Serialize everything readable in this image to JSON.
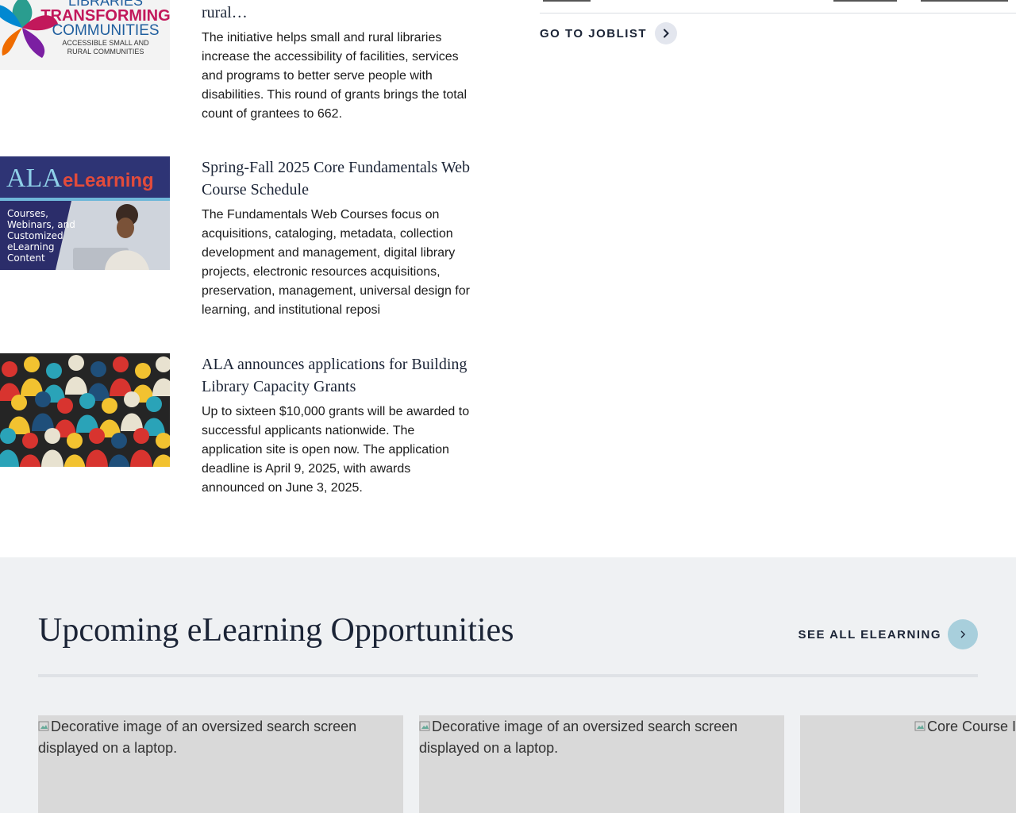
{
  "news": [
    {
      "title_fragment": "rural…",
      "logo": {
        "line1": "LIBRARIES",
        "line2": "TRANSFORMING",
        "line3": "COMMUNITIES",
        "line4": "ACCESSIBLE SMALL AND",
        "line5": "RURAL COMMUNITIES"
      },
      "desc": "The initiative helps small and rural libraries increase the accessibility of facilities, services and programs to better serve people with disabilities. This round of grants brings the total count of grantees to 662."
    },
    {
      "title": "Spring-Fall 2025 Core Fundamentals Web Course Schedule",
      "banner": {
        "ala": "ALA",
        "elearning": "eLearning",
        "l1": "Courses,",
        "l2": "Webinars, and",
        "l3": "Customized",
        "l4": "eLearning",
        "l5": "Content"
      },
      "desc": "The Fundamentals Web Courses focus on acquisitions, cataloging, metadata, collection development and management, digital library projects, electronic resources acquisitions, preservation, management, universal design for learning, and institutional reposi"
    },
    {
      "title": "ALA announces applications for Building Library Capacity Grants",
      "desc": "Up to sixteen $10,000 grants will be awarded to successful applicants nationwide. The application site is open now. The application deadline is April 9, 2025, with awards announced on June 3, 2025."
    }
  ],
  "joblist": {
    "link_label": "GO TO JOBLIST"
  },
  "elearning": {
    "heading": "Upcoming eLearning Opportunities",
    "see_all_label": "SEE ALL ELEARNING",
    "cards": [
      {
        "image_alt": "Decorative image of an oversized search screen displayed on a laptop."
      },
      {
        "image_alt": "Decorative image of an oversized search screen displayed on a laptop."
      },
      {
        "image_alt": "Core Course I"
      }
    ]
  },
  "colors": {
    "accent_navy": "#1b2436",
    "ala_red": "#e24b3b",
    "section_bg": "#eff1f3",
    "see_all_circle": "#a8cfdc"
  },
  "icons": {
    "arrow": "chevron-right-icon",
    "broken_image": "broken-image-icon"
  }
}
